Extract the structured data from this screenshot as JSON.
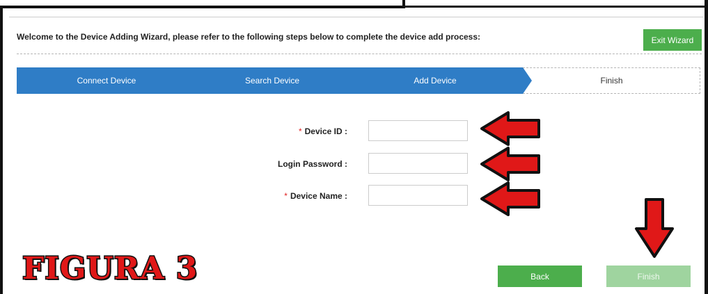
{
  "wizard": {
    "welcome_text": "Welcome to the Device Adding Wizard, please refer to the following steps below to complete the device add process:",
    "exit_label": "Exit Wizard"
  },
  "steps": [
    {
      "label": "Connect Device",
      "state": "done"
    },
    {
      "label": "Search Device",
      "state": "done"
    },
    {
      "label": "Add Device",
      "state": "current"
    },
    {
      "label": "Finish",
      "state": "pending"
    }
  ],
  "form": {
    "device_id": {
      "label": "Device ID :",
      "required": true,
      "value": ""
    },
    "login_password": {
      "label": "Login Password :",
      "required": false,
      "value": ""
    },
    "device_name": {
      "label": "Device Name :",
      "required": true,
      "value": ""
    },
    "required_marker": "*"
  },
  "buttons": {
    "back_label": "Back",
    "finish_label": "Finish"
  },
  "annotation": {
    "caption": "FIGURA 3",
    "arrow_icon": "red-arrow-icon"
  },
  "colors": {
    "step_bar": "#2f7dc6",
    "primary_button": "#4cae4c",
    "disabled_button": "#9fd49f",
    "required": "#e02020",
    "annotation_red": "#e01818"
  }
}
